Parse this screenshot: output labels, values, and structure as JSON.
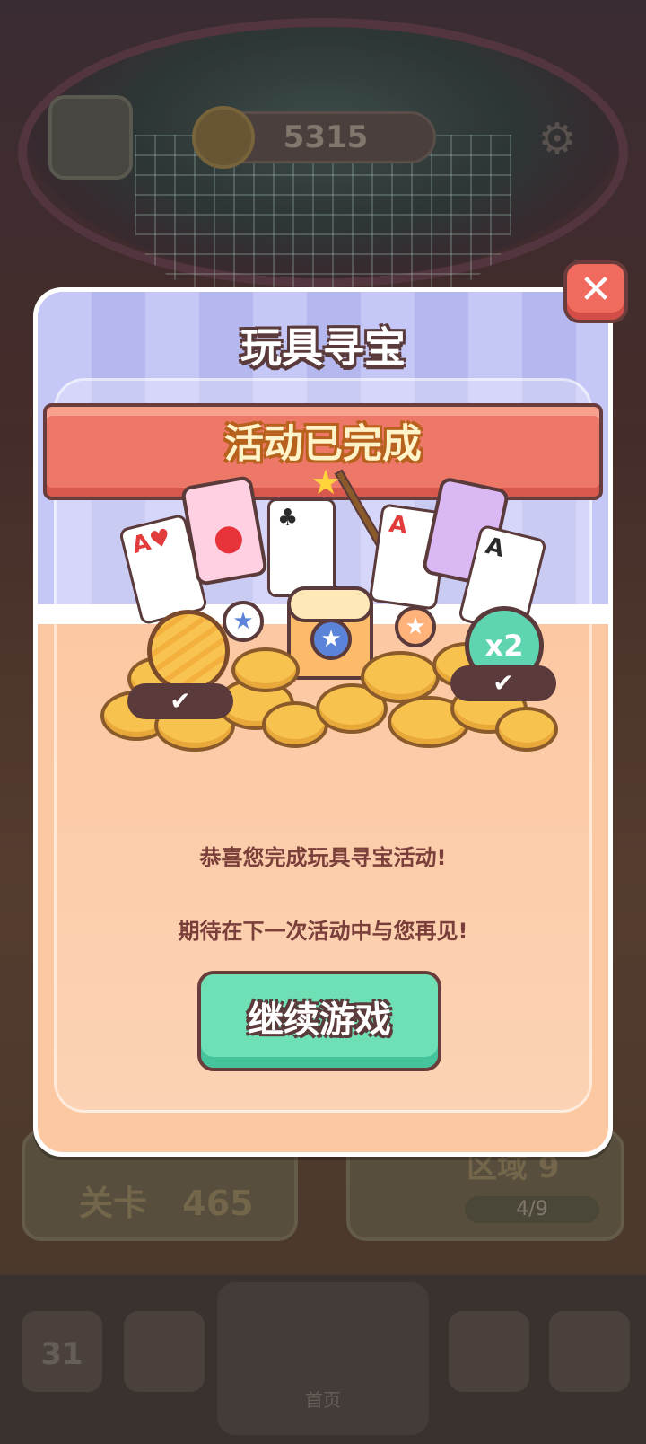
{
  "background": {
    "coin_count": "5315",
    "level_card": {
      "label": "关卡",
      "value": "465"
    },
    "zone_card": {
      "label": "区域 9",
      "progress": "4/9"
    },
    "calendar_day": "31",
    "nav_home_label": "首页"
  },
  "modal": {
    "title": "玩具寻宝",
    "ribbon_text": "活动已完成",
    "multiplier_badge": "x2",
    "check_mark": "✔",
    "message_line1": "恭喜您完成玩具寻宝活动!",
    "message_line2": "期待在下一次活动中与您再见!",
    "continue_button": "继续游戏",
    "close_icon": "✕"
  },
  "colors": {
    "header_lilac": "#b9bcf3",
    "panel_peach": "#fcc8a2",
    "ribbon_red": "#ee7868",
    "button_green": "#6fe0b5",
    "outline_brown": "#5a3a3a"
  }
}
